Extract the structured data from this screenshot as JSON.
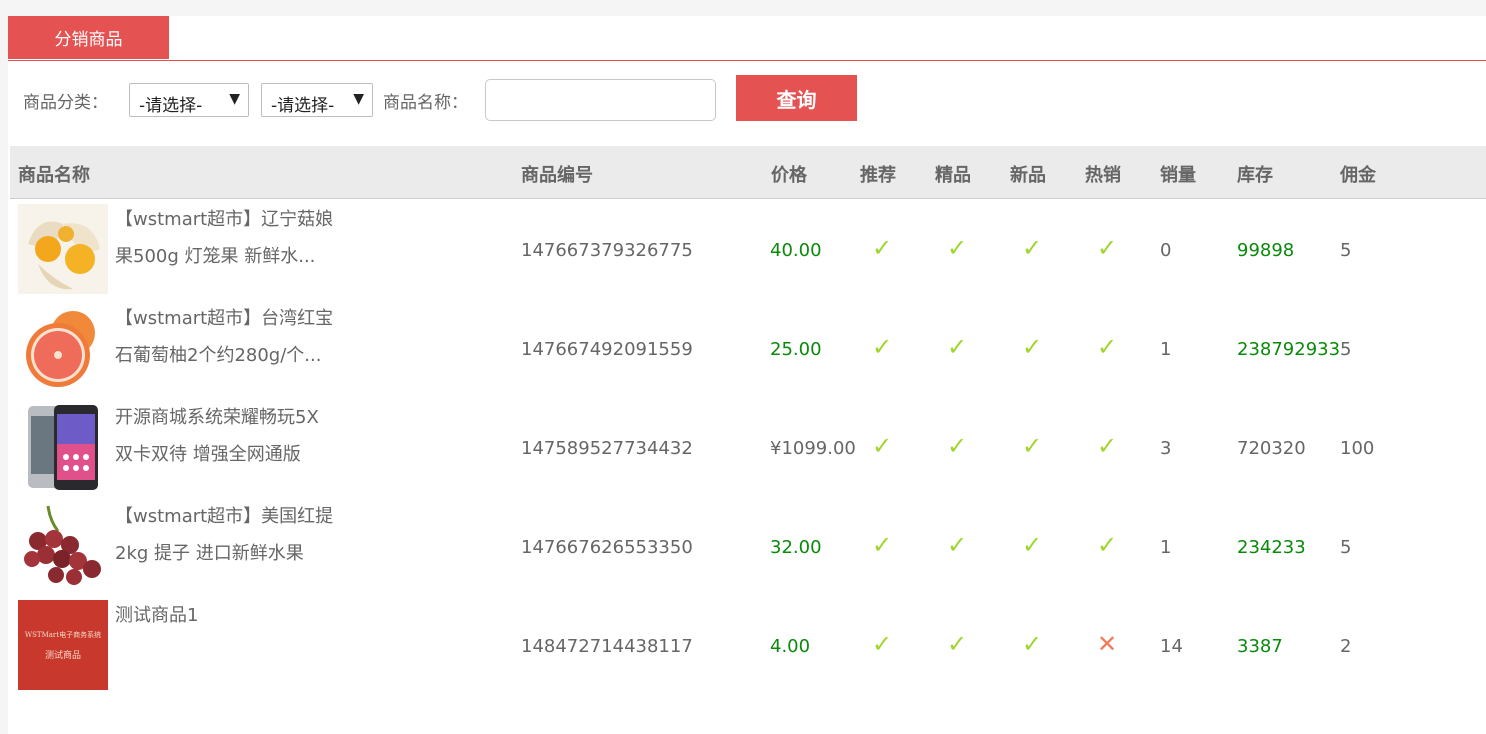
{
  "tab": {
    "label": "分销商品"
  },
  "filters": {
    "category_label": "商品分类：",
    "category1": "-请选择-",
    "category2": "-请选择-",
    "name_label": "商品名称：",
    "name_value": "",
    "query_button": "查询"
  },
  "table": {
    "headers": {
      "name": "商品名称",
      "code": "商品编号",
      "price": "价格",
      "recommend": "推荐",
      "best": "精品",
      "new": "新品",
      "hot": "热销",
      "sales": "销量",
      "stock": "库存",
      "commission": "佣金"
    },
    "rows": [
      {
        "name_line1": "【wstmart超市】辽宁菇娘",
        "name_line2": "果500g 灯笼果 新鲜水...",
        "code": "147667379326775",
        "price": "40.00",
        "recommend": "✓",
        "best": "✓",
        "new": "✓",
        "hot": "✓",
        "sales": "0",
        "stock": "99898",
        "commission": "5"
      },
      {
        "name_line1": "【wstmart超市】台湾红宝",
        "name_line2": "石葡萄柚2个约280g/个...",
        "code": "147667492091559",
        "price": "25.00",
        "recommend": "✓",
        "best": "✓",
        "new": "✓",
        "hot": "✓",
        "sales": "1",
        "stock": "238792933",
        "commission": "5"
      },
      {
        "name_line1": "开源商城系统荣耀畅玩5X",
        "name_line2": "双卡双待 增强全网通版",
        "code": "147589527734432",
        "price": "¥1099.00",
        "recommend": "✓",
        "best": "✓",
        "new": "✓",
        "hot": "✓",
        "sales": "3",
        "stock": "720320",
        "commission": "100"
      },
      {
        "name_line1": "【wstmart超市】美国红提",
        "name_line2": "2kg 提子 进口新鲜水果",
        "code": "147667626553350",
        "price": "32.00",
        "recommend": "✓",
        "best": "✓",
        "new": "✓",
        "hot": "✓",
        "sales": "1",
        "stock": "234233",
        "commission": "5"
      },
      {
        "name_line1": "测试商品1",
        "name_line2": "",
        "code": "148472714438117",
        "price": "4.00",
        "recommend": "✓",
        "best": "✓",
        "new": "✓",
        "hot": "✕",
        "sales": "14",
        "stock": "3387",
        "commission": "2"
      }
    ],
    "thumb5": {
      "line1": "WSTMart电子商务系统",
      "line2": "测试商品"
    }
  },
  "colors": {
    "accent": "#e45252",
    "green_value": "#0a8a0a",
    "check": "#9fd62d",
    "cross": "#f07b5a"
  }
}
